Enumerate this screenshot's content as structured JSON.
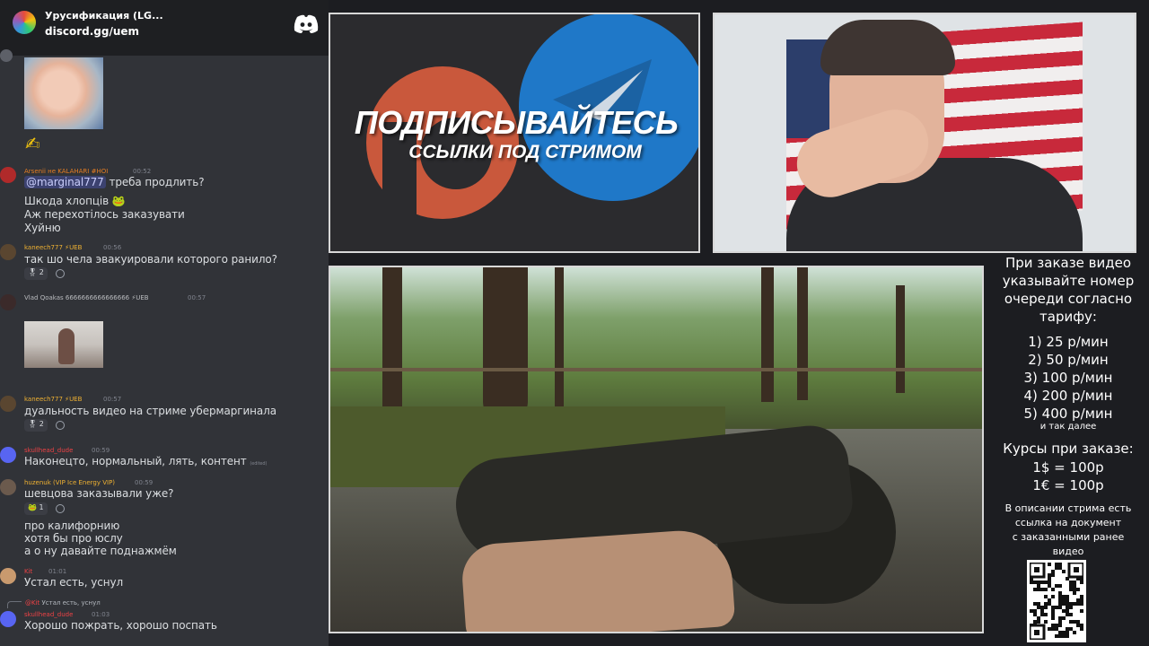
{
  "header": {
    "server_name": "Урусификация (LG...",
    "invite": "discord.gg/uem",
    "logo_icon": "discord-logo-icon"
  },
  "messages": [
    {
      "type": "image",
      "image_icon": "baby-photo"
    },
    {
      "type": "emoji",
      "emoji_icon": "writing-hand-emoji",
      "emoji": "✍"
    },
    {
      "author": "Arsenii не KALAHARI #HOI",
      "time": "00:52",
      "mention": "@marginal777",
      "lines": [
        "треба продлить?",
        "Шкода хлопців 🐸",
        "Аж перехотілось заказувати",
        "Хуйню"
      ]
    },
    {
      "author": "kaneech777",
      "badge": "UEB",
      "time": "00:56",
      "lines": [
        "так шо чела эвакуировали которого ранило?"
      ],
      "reaction": {
        "emoji": "🎖",
        "count": "2"
      }
    },
    {
      "author": "Vlad Qoakas 6666666666666666",
      "badge": "UEB",
      "time": "00:57",
      "image_icon": "woman-photo"
    },
    {
      "author": "kaneech777",
      "badge": "UEB",
      "time": "00:57",
      "lines": [
        "дуальность видео на стриме убермаргинала"
      ],
      "reaction": {
        "emoji": "🎖",
        "count": "2"
      }
    },
    {
      "author": "skullhead_dude",
      "time": "00:59",
      "lines": [
        "Наконецто, нормальный, лять, контент"
      ],
      "edited": "(edited)"
    },
    {
      "author": "huzenuk (VIP Ice Energy VIP)",
      "time": "00:59",
      "lines": [
        "шевцова заказывали уже?"
      ],
      "reaction": {
        "emoji": "🐸",
        "count": "1"
      }
    },
    {
      "continuation": true,
      "lines": [
        "про калифорнию",
        "хотя бы про юслу",
        "а о ну давайте поднажмём"
      ]
    },
    {
      "author": "Kit",
      "time": "01:01",
      "lines": [
        "Устал есть, уснул"
      ]
    },
    {
      "author": "skullhead_dude",
      "time": "01:03",
      "reply_to": {
        "author": "@Kit",
        "text": "Устал есть, уснул"
      },
      "lines": [
        "Хорошо пожрать, хорошо поспать"
      ]
    }
  ],
  "promo": {
    "title": "ПОДПИСЫВАЙТЕСЬ",
    "subtitle": "ССЫЛКИ ПОД СТРИМОМ",
    "logos": [
      "patreon-logo",
      "telegram-logo"
    ]
  },
  "colors": {
    "discord_bg": "#313338",
    "discord_header": "#1e1f22",
    "patreon": "#c9583c",
    "telegram": "#1f78c8",
    "name_orange": "#e67e22",
    "name_red": "#ed4245",
    "name_gold": "#f0b232"
  },
  "info": {
    "intro": [
      "При заказе видео",
      "указывайте номер",
      "очереди согласно",
      "тарифу:"
    ],
    "tariffs": [
      "1) 25 р/мин",
      "2) 50 р/мин",
      "3) 100 р/мин",
      "4) 200 р/мин",
      "5) 400 р/мин"
    ],
    "etc": "и так далее",
    "rates_title": "Курсы при заказе:",
    "rates": [
      "1$ = 100р",
      "1€ = 100р"
    ],
    "description": [
      "В описании стрима есть",
      "ссылка на документ",
      "с заказанными ранее",
      "видео"
    ],
    "qr_icon": "qr-code"
  }
}
